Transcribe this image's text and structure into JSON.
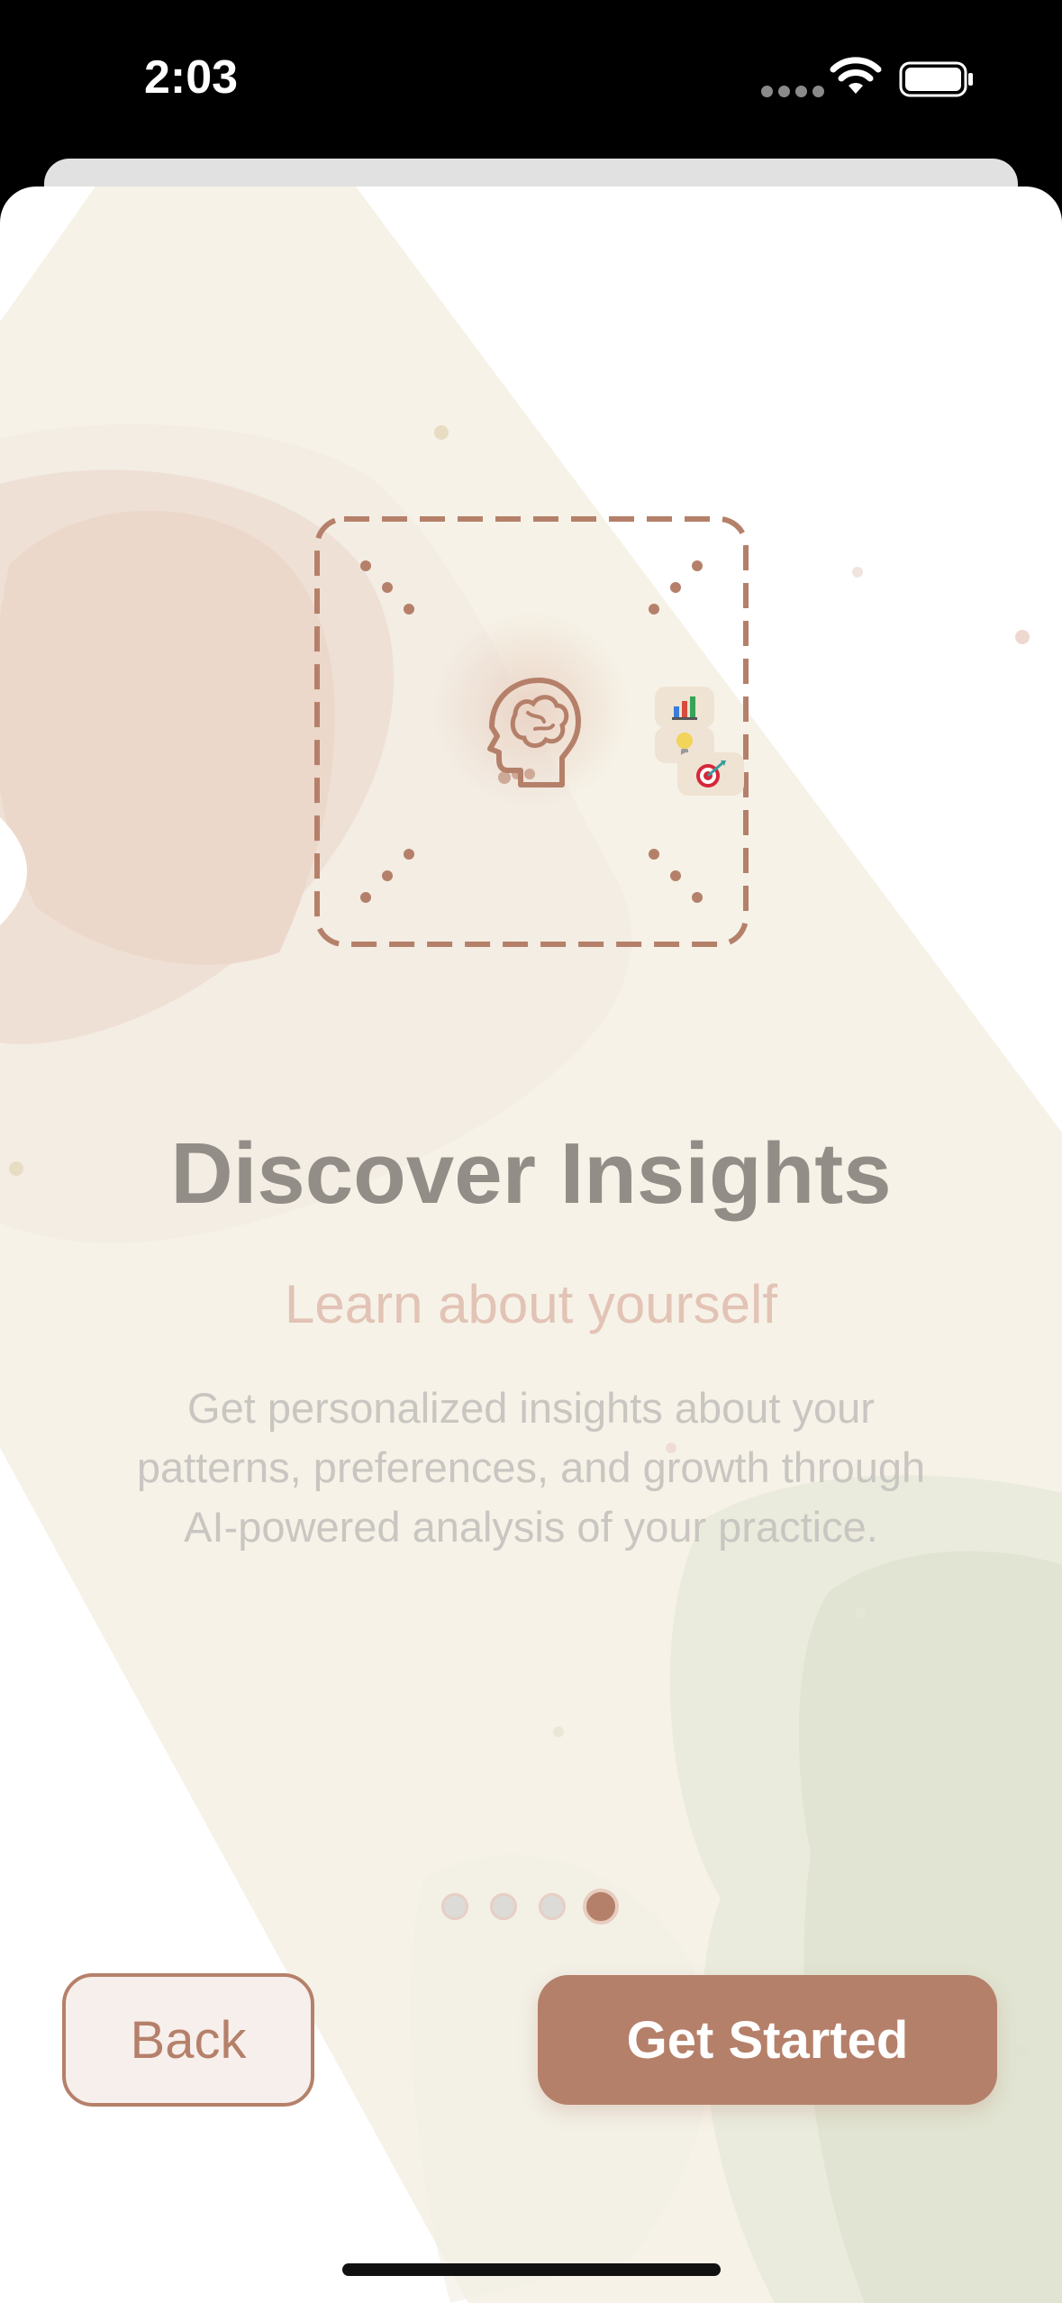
{
  "status_bar": {
    "time": "2:03",
    "icons": [
      "cellular-icon",
      "wifi-icon",
      "battery-icon"
    ]
  },
  "onboarding": {
    "title": "Discover Insights",
    "subtitle": "Learn about yourself",
    "description": "Get personalized insights about your patterns, preferences, and growth through AI-powered analysis of your practice.",
    "illustration_icons": [
      "brain-icon",
      "bar-chart-icon",
      "lightbulb-icon",
      "target-icon"
    ],
    "page_indicator": {
      "total": 4,
      "current": 4
    }
  },
  "buttons": {
    "back_label": "Back",
    "primary_label": "Get Started"
  },
  "colors": {
    "accent": "#b5806a",
    "title": "#928d87",
    "subtitle": "#e2c3b5",
    "description": "#c9c6c2",
    "background_card": "#ffffff"
  }
}
